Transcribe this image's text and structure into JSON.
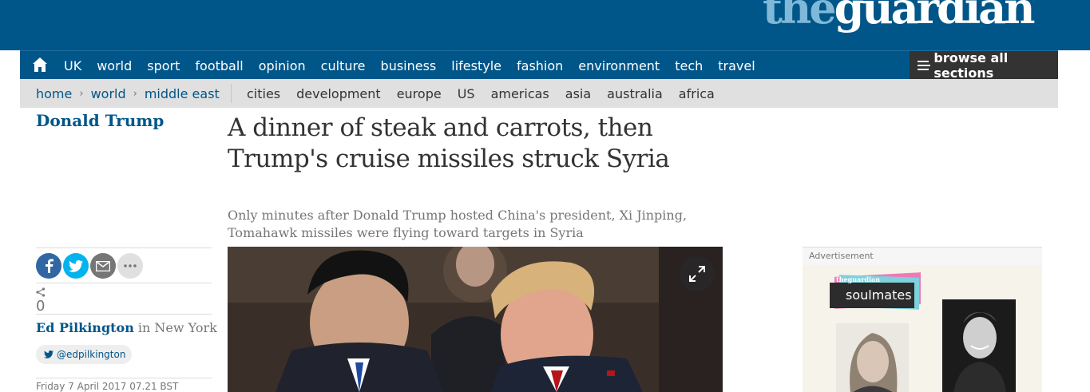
{
  "logo": {
    "the": "the",
    "guardian": "guardian"
  },
  "nav": {
    "items": [
      "UK",
      "world",
      "sport",
      "football",
      "opinion",
      "culture",
      "business",
      "lifestyle",
      "fashion",
      "environment",
      "tech",
      "travel"
    ],
    "browse_label": "browse all sections"
  },
  "breadcrumb": {
    "home": "home",
    "world": "world",
    "region": "middle east",
    "separator": "›"
  },
  "subnav": [
    "cities",
    "development",
    "europe",
    "US",
    "americas",
    "asia",
    "australia",
    "africa"
  ],
  "article": {
    "series": "Donald Trump",
    "headline": "A dinner of steak and carrots, then Trump's cruise missiles struck Syria",
    "standfirst": "Only minutes after Donald Trump hosted China's president, Xi Jinping, Tomahawk missiles were flying toward targets in Syria",
    "share_count": "0",
    "author": "Ed Pilkington",
    "byline_location": "in New York",
    "twitter_handle": "@edpilkington",
    "date": "Friday 7 April 2017 07.21 BST"
  },
  "ad": {
    "label": "Advertisement",
    "brand_small": "theguardian",
    "brand": "soulmates"
  },
  "colors": {
    "brand_blue": "#005689",
    "subnav_grey": "#e0e0e0",
    "facebook": "#3067a3",
    "twitter": "#03b3ee"
  }
}
